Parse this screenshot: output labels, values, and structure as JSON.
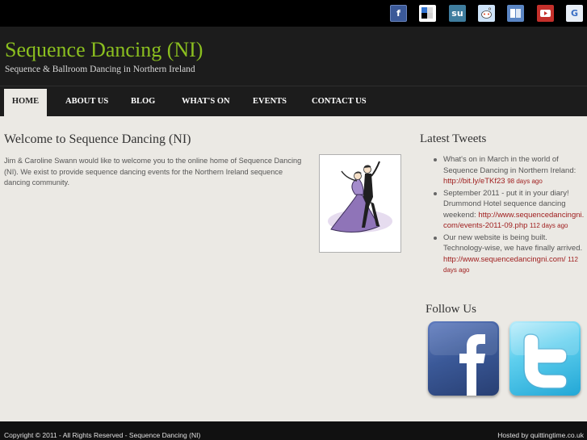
{
  "social_bar": {
    "icons": [
      {
        "name": "facebook-share-icon",
        "glyph": "f",
        "color": "#3b5998"
      },
      {
        "name": "delicious-share-icon",
        "glyph": "",
        "color": "#ffffff"
      },
      {
        "name": "stumbleupon-share-icon",
        "glyph": "su",
        "color": "#3f7d9e"
      },
      {
        "name": "reddit-share-icon",
        "glyph": "",
        "color": "#cee3f8"
      },
      {
        "name": "myspace-share-icon",
        "glyph": "",
        "color": "#5b86c4"
      },
      {
        "name": "youtube-share-icon",
        "glyph": "",
        "color": "#c4302b"
      },
      {
        "name": "google-share-icon",
        "glyph": "G",
        "color": "#e8eef6"
      }
    ]
  },
  "header": {
    "title": "Sequence Dancing (NI)",
    "subtitle": "Sequence & Ballroom Dancing in Northern Ireland"
  },
  "nav": {
    "items": [
      "HOME",
      "ABOUT US",
      "BLOG",
      "WHAT'S ON",
      "EVENTS",
      "CONTACT US"
    ],
    "active": "HOME"
  },
  "main": {
    "heading": "Welcome to Sequence Dancing (NI)",
    "intro": "Jim & Caroline Swann would like to welcome you to the online home of Sequence Dancing (NI). We exist to provide sequence dancing events for the Northern Ireland sequence dancing community."
  },
  "sidebar": {
    "tweets_heading": "Latest Tweets",
    "tweets": [
      {
        "text": "What's on in March in the world of Sequence Dancing in Northern Ireland:",
        "link": "http://bit.ly/eTKf23",
        "ago": "98 days ago"
      },
      {
        "text": "September 2011 - put it in your diary! Drummond Hotel sequence dancing weekend:",
        "link": "http://www.sequencedancingni.com/events-2011-09.php",
        "ago": "112 days ago"
      },
      {
        "text": "Our new website is being built. Technology-wise, we have finally arrived.",
        "link": "http://www.sequencedancingni.com/",
        "ago": "112 days ago"
      }
    ],
    "follow_heading": "Follow Us"
  },
  "footer": {
    "copyright": "Copyright © 2011 - All Rights Reserved - Sequence Dancing (NI)",
    "hosted": "Hosted by quittingtime.co.uk"
  },
  "colors": {
    "title_green": "#8bbf1f",
    "link_red": "#a02020",
    "header_bg": "#1c1c1c",
    "page_bg": "#ebe9e4"
  }
}
